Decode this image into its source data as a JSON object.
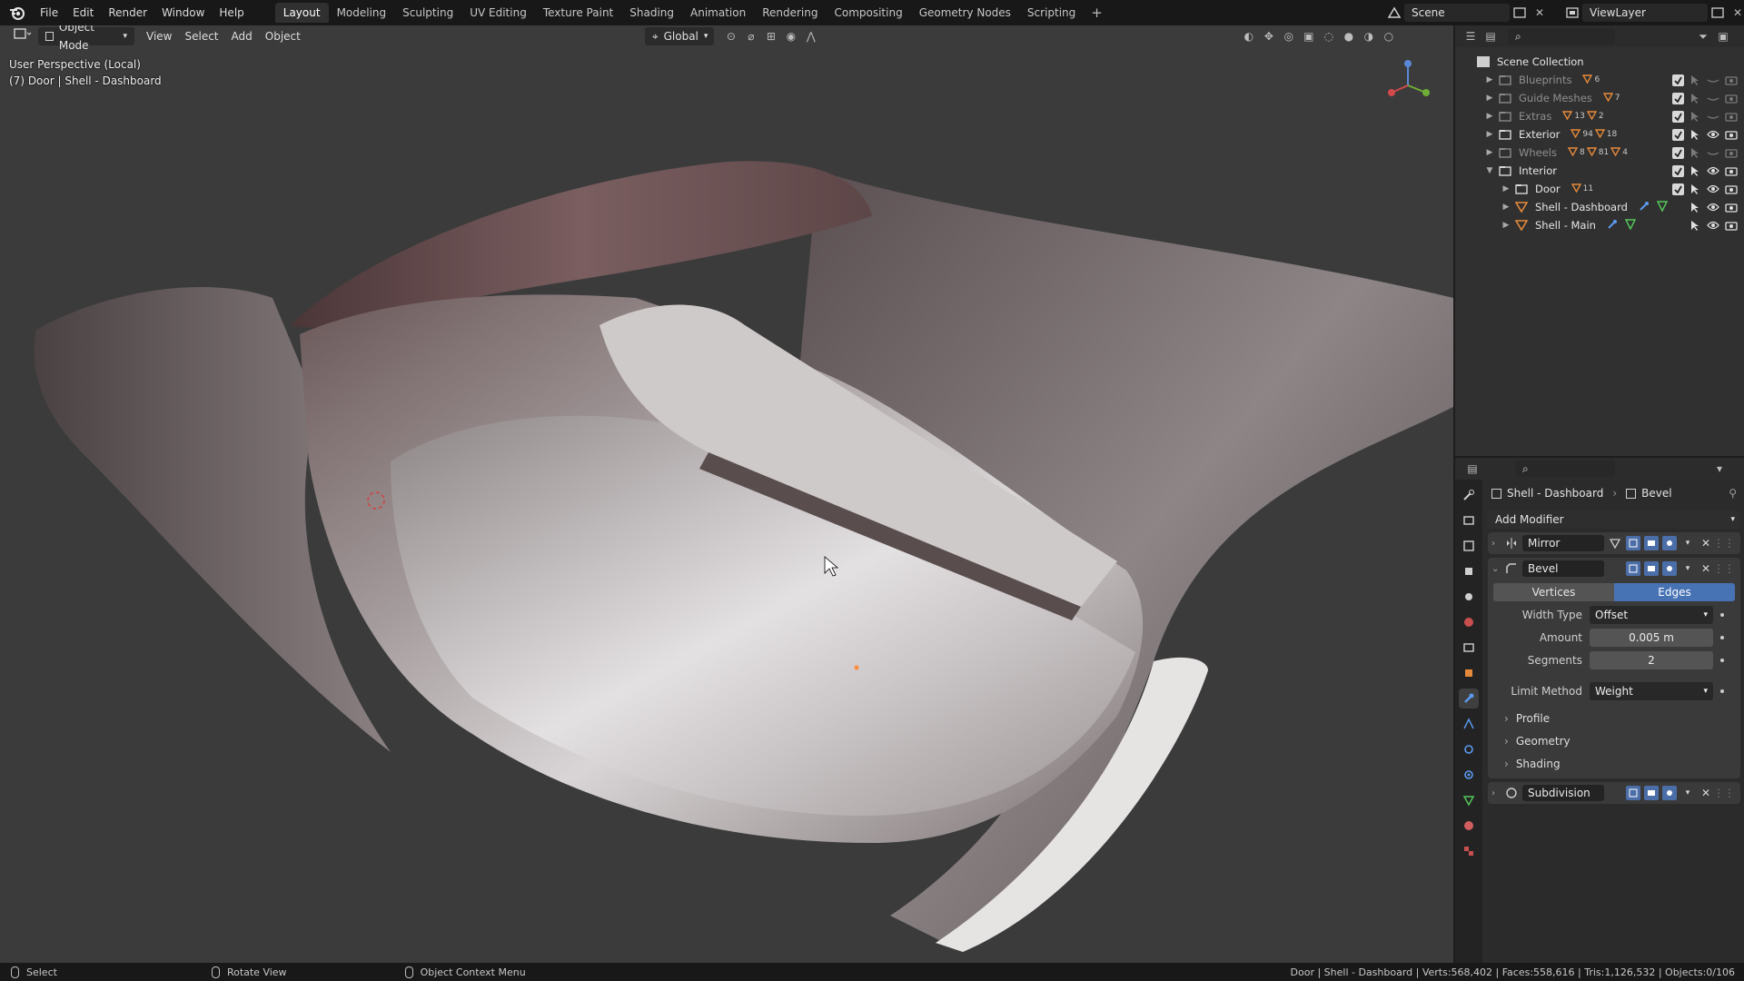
{
  "menu": [
    "File",
    "Edit",
    "Render",
    "Window",
    "Help"
  ],
  "workspaces": [
    "Layout",
    "Modeling",
    "Sculpting",
    "UV Editing",
    "Texture Paint",
    "Shading",
    "Animation",
    "Rendering",
    "Compositing",
    "Geometry Nodes",
    "Scripting"
  ],
  "active_workspace": "Layout",
  "scene": "Scene",
  "view_layer": "ViewLayer",
  "viewport": {
    "mode": "Object Mode",
    "menus": [
      "View",
      "Select",
      "Add",
      "Object"
    ],
    "transform_orientation": "Global",
    "info_line1": "User Perspective (Local)",
    "info_line2": "(7) Door | Shell - Dashboard"
  },
  "outliner": {
    "root": "Scene Collection",
    "rows": [
      {
        "name": "Blueprints",
        "count": "6"
      },
      {
        "name": "Guide Meshes",
        "count": "7"
      },
      {
        "name": "Extras",
        "count": "13",
        "count2": "2"
      },
      {
        "name": "Exterior",
        "count": "94",
        "count2": "18"
      },
      {
        "name": "Wheels",
        "count": "8",
        "count2": "81",
        "count3": "4"
      },
      {
        "name": "Interior",
        "count": ""
      },
      {
        "name": "Door",
        "count": "11"
      },
      {
        "name": "Shell - Dashboard",
        "count": ""
      },
      {
        "name": "Shell - Main",
        "count": ""
      }
    ]
  },
  "properties": {
    "object": "Shell - Dashboard",
    "modifier": "Bevel",
    "add_modifier": "Add Modifier",
    "modifiers": [
      "Mirror",
      "Bevel",
      "Subdivision"
    ],
    "affect_vertices": "Vertices",
    "affect_edges": "Edges",
    "width_type_label": "Width Type",
    "width_type": "Offset",
    "amount_label": "Amount",
    "amount": "0.005 m",
    "segments_label": "Segments",
    "segments": "2",
    "limit_method_label": "Limit Method",
    "limit_method": "Weight",
    "subpanels": [
      "Profile",
      "Geometry",
      "Shading"
    ]
  },
  "status": {
    "select": "Select",
    "rotate": "Rotate View",
    "context": "Object Context Menu",
    "stats": "Door | Shell - Dashboard | Verts:568,402 | Faces:558,616 | Tris:1,126,532 | Objects:0/106"
  }
}
